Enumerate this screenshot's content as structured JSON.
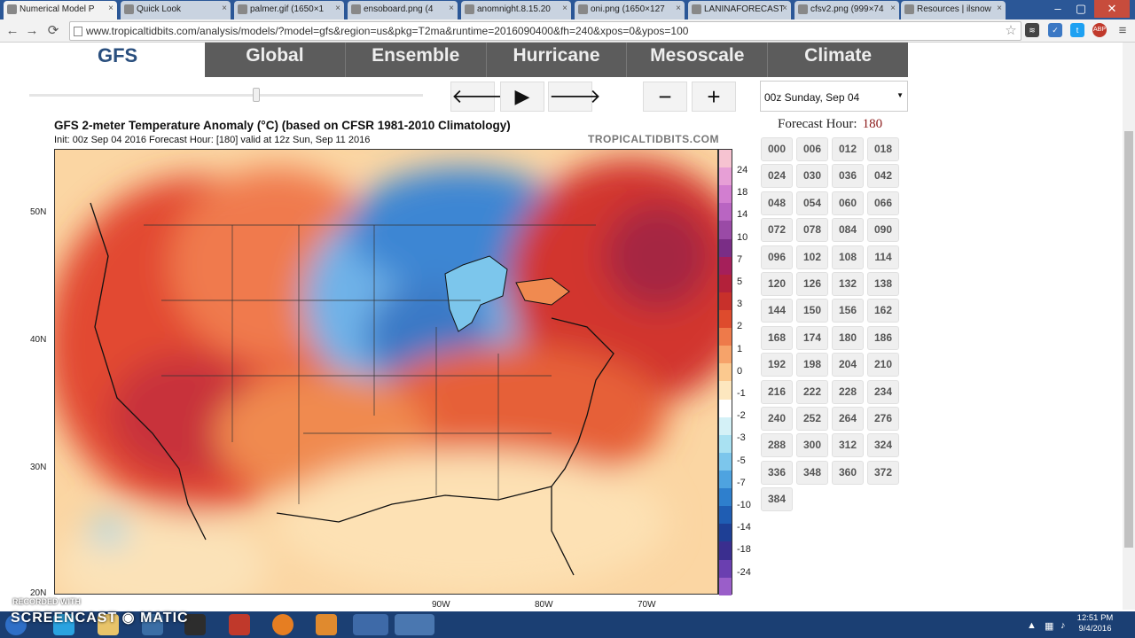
{
  "browser": {
    "tabs": [
      {
        "label": "Numerical Model P",
        "active": true
      },
      {
        "label": "Quick Look"
      },
      {
        "label": "palmer.gif (1650×1"
      },
      {
        "label": "ensoboard.png (4"
      },
      {
        "label": "anomnight.8.15.20"
      },
      {
        "label": "oni.png (1650×127"
      },
      {
        "label": "LANINAFORECAST"
      },
      {
        "label": "cfsv2.png (999×74"
      },
      {
        "label": "Resources | ilsnow"
      }
    ],
    "url": "www.tropicaltidbits.com/analysis/models/?model=gfs&region=us&pkg=T2ma&runtime=2016090400&fh=240&xpos=0&ypos=100",
    "ext_abp": "ABP"
  },
  "site": {
    "logo": "GFS",
    "nav": [
      "Global",
      "Ensemble",
      "Hurricane",
      "Mesoscale",
      "Climate"
    ],
    "controls": {
      "back": "🡐",
      "play": "▶",
      "forward": "🡒",
      "zoom_out": "−",
      "zoom_in": "+"
    },
    "run_select": "00z Sunday, Sep 04",
    "forecast_hour_label": "Forecast Hour:",
    "forecast_hour_value": "180",
    "hours": [
      "000",
      "006",
      "012",
      "018",
      "024",
      "030",
      "036",
      "042",
      "048",
      "054",
      "060",
      "066",
      "072",
      "078",
      "084",
      "090",
      "096",
      "102",
      "108",
      "114",
      "120",
      "126",
      "132",
      "138",
      "144",
      "150",
      "156",
      "162",
      "168",
      "174",
      "180",
      "186",
      "192",
      "198",
      "204",
      "210",
      "216",
      "222",
      "228",
      "234",
      "240",
      "252",
      "264",
      "276",
      "288",
      "300",
      "312",
      "324",
      "336",
      "348",
      "360",
      "372",
      "384"
    ]
  },
  "chart": {
    "title": "GFS 2-meter Temperature Anomaly (°C) (based on CFSR 1981-2010 Climatology)",
    "subtitle": "Init: 00z Sep 04 2016   Forecast Hour: [180]   valid at 12z Sun, Sep 11 2016",
    "brand": "TROPICALTIDBITS.COM",
    "lat_labels": [
      "50N",
      "40N",
      "30N",
      "20N"
    ],
    "lon_labels": [
      "90W",
      "80W",
      "70W"
    ]
  },
  "chart_data": {
    "type": "heatmap",
    "title": "GFS 2-meter Temperature Anomaly (°C) (based on CFSR 1981-2010 Climatology)",
    "colorbar_ticks": [
      "24",
      "18",
      "14",
      "10",
      "7",
      "5",
      "3",
      "2",
      "1",
      "0",
      "-1",
      "-2",
      "-3",
      "-5",
      "-7",
      "-10",
      "-14",
      "-18",
      "-24"
    ],
    "colorbar_colors": [
      "#f6c3d1",
      "#e79fd6",
      "#d27ed0",
      "#b965c2",
      "#9a4aa6",
      "#7a2d86",
      "#a51f5a",
      "#b3213a",
      "#c8302b",
      "#de4b2d",
      "#ee7a4a",
      "#f6a36a",
      "#fbc98f",
      "#fde7bf",
      "#ffffff",
      "#d4f1f7",
      "#a9e1f2",
      "#7cc6ec",
      "#4ea3e0",
      "#2e7fcd",
      "#1f5db3",
      "#1e3f95",
      "#3a2e8f",
      "#6a3fb0",
      "#9a5ec9"
    ]
  },
  "taskbar": {
    "watermark_small": "RECORDED WITH",
    "watermark_big": "SCREENCAST",
    "watermark_suffix": "MATIC",
    "time": "12:51 PM",
    "date": "9/4/2016"
  }
}
